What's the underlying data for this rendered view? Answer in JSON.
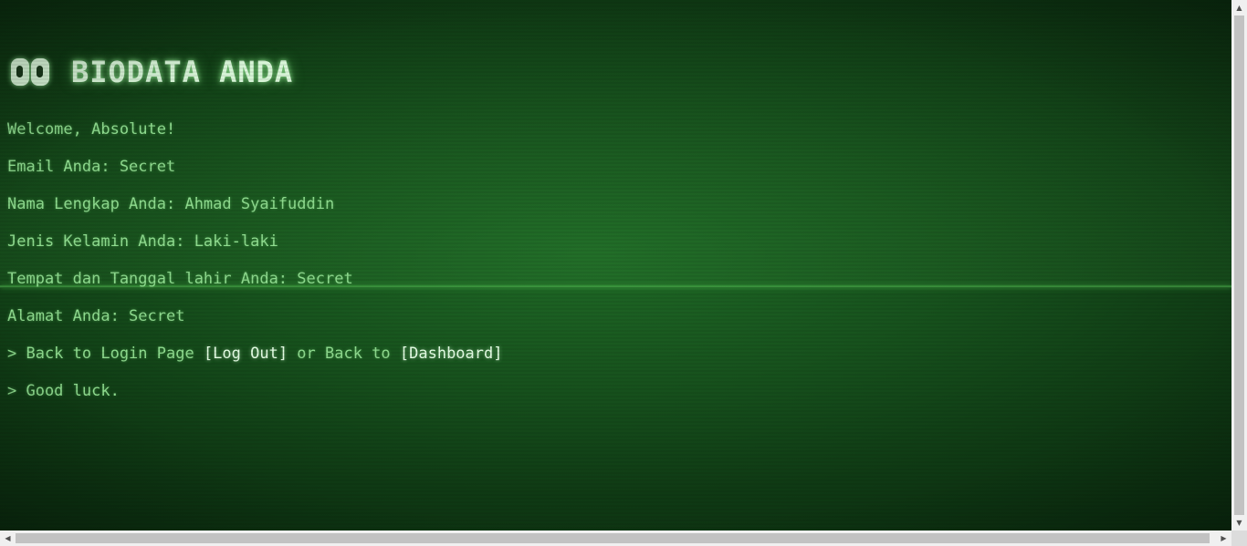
{
  "header": {
    "title": "BIODATA ANDA"
  },
  "lines": {
    "welcome": "Welcome, Absolute!",
    "email": "Email Anda: Secret",
    "nama": "Nama Lengkap Anda: Ahmad Syaifuddin",
    "jenis_kelamin": "Jenis Kelamin Anda: Laki-laki",
    "ttl": "Tempat dan Tanggal lahir Anda: Secret",
    "alamat": "Alamat Anda: Secret",
    "good_luck": "> Good luck."
  },
  "nav": {
    "prefix": "> Back to Login Page ",
    "logout_label": "[Log Out]",
    "middle": " or Back to ",
    "dashboard_label": "[Dashboard]"
  },
  "colors": {
    "text": "#8fdc8f",
    "highlight": "#e6ffe6",
    "background": "#17521d"
  }
}
